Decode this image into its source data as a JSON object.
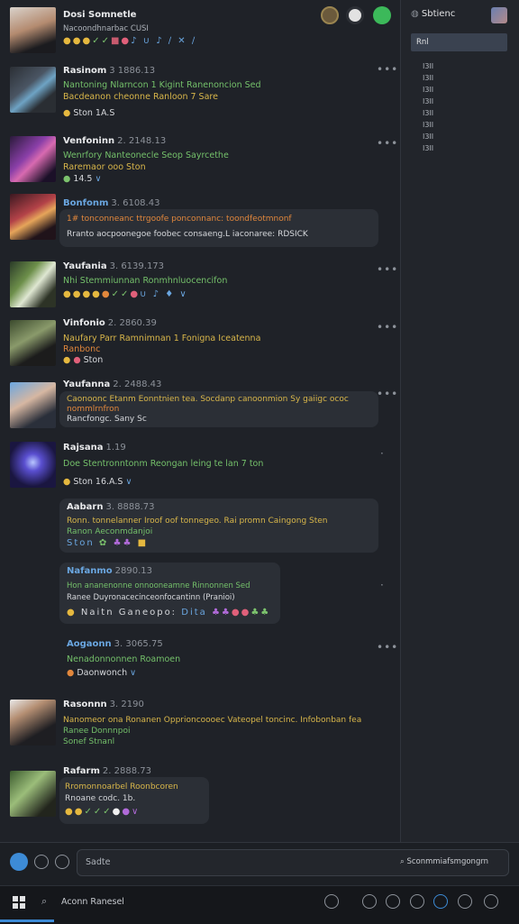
{
  "header": {
    "title": "Dosi Somnetle",
    "subtitle": "Nacoondhnarbac CUSI"
  },
  "sidebar": {
    "title": "Sbtienc",
    "active_item": "Rnl",
    "items": [
      "I3II",
      "I3II",
      "I3II",
      "I3II",
      "I3II",
      "I3II",
      "I3II",
      "I3II"
    ]
  },
  "posts": [
    {
      "author": "Rasinom",
      "time": "3 1886.13",
      "lines": [
        "Nantoning Nlarncon 1 Kigint Ranenoncion Sed",
        "Bacdeanon cheonne Ranloon 7 Sare"
      ],
      "reactions": "Ston  1A.S"
    },
    {
      "author": "Venfoninn",
      "time": "2. 2148.13",
      "lines": [
        "Wenrfory Nanteonecle Seop Sayrcethe",
        "Raremaor ooo Ston"
      ],
      "reactions": "14.5"
    },
    {
      "author": "Bonfonm",
      "time": "3. 6108.43",
      "lines": [
        "1# tonconneanc ttrgoofe ponconnanc: toondfeotmnonf",
        "Rranto aocpoonegoe foobec consaeng.L iaconaree: RDSICK"
      ],
      "reactions": ""
    },
    {
      "author": "Yaufania",
      "time": "3. 6139.173",
      "lines": [
        "Nhi Stemmiunnan  Ronmhnluocencifon"
      ],
      "reactions": ""
    },
    {
      "author": "Vinfonio",
      "time": "2. 2860.39",
      "lines": [
        "Naufary Parr Ramnimnan 1 Fonigna Iceatenna",
        "Ranbonc"
      ],
      "reactions": "Ston"
    },
    {
      "author": "Yaufanna",
      "time": "2. 2488.43",
      "lines": [
        "Caonoonc Etanm Eonntnien tea. Socdanp canoonmion Sy gaiigc  ococ",
        "nommlrnfron",
        "Rancfongc.  Sany Sc"
      ],
      "reactions": ""
    },
    {
      "author": "Rajsana",
      "time": "1.19",
      "lines": [
        "Doe Stentronntonm  Reongan leing te lan 7 ton"
      ],
      "reactions": "Ston  16.A.S"
    },
    {
      "author": "Aabarn",
      "time": "3. 8888.73",
      "lines": [
        "Ronn. tonnelanner Iroof oof tonnegeo. Rai promn Caingong Sten",
        "Ranon Aeconmdanjoi"
      ],
      "reactions": "Ston"
    },
    {
      "author": "Nafanmo",
      "time": "2890.13",
      "lines": [
        "Hon ananenonne onnooneamne Rinnonnen Sed",
        "Ranee Duyronacecinceonfocantinn (Pranioi)"
      ],
      "reactions": "Naitn Ganeopo:"
    },
    {
      "author": "Aogaonn",
      "time": "3. 3065.75",
      "lines": [
        "Nenadonnonnen Roamoen"
      ],
      "reactions": "Daonwonch"
    },
    {
      "author": "Rasonnn",
      "time": "3. 2190",
      "lines": [
        "Nanomeor ona Ronanen Opprioncoooec Vateopel toncinc. Infobonban fea",
        "Ranee Donnnpoi",
        "Sonef Stnanl"
      ],
      "reactions": ""
    },
    {
      "author": "Rafarm",
      "time": "2. 2888.73",
      "lines": [
        "Rromonnoarbel Roonbcoren",
        "Rnoane codc. 1b."
      ],
      "reactions": ""
    }
  ],
  "composer": {
    "placeholder": "Sadte",
    "right_hint": "Sconmmiafsmgongrn"
  },
  "taskbar": {
    "search_label": "Aconn Ranesel"
  },
  "colors": {
    "accent_blue": "#3d8bd6",
    "green": "#74c06a",
    "yellow": "#d8b64a",
    "pink": "#e0607a"
  }
}
